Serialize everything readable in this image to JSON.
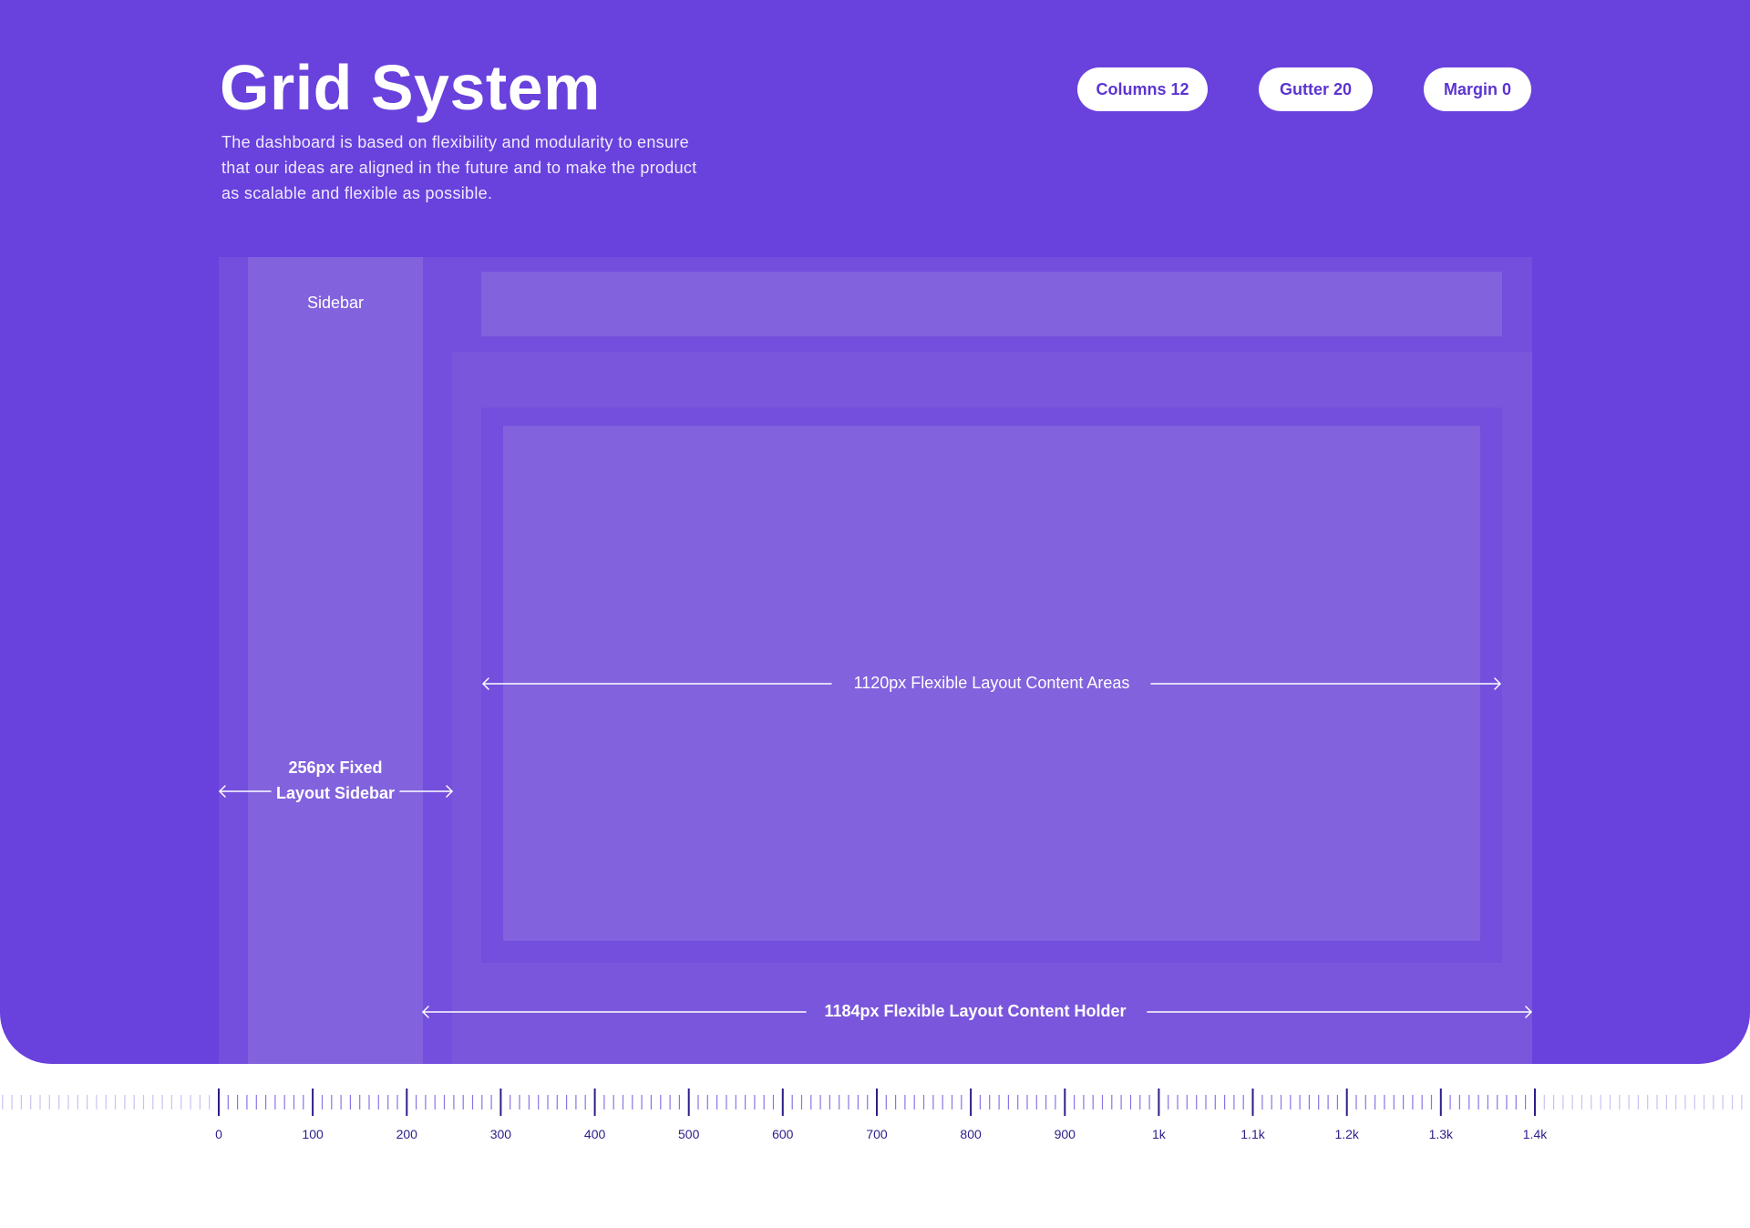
{
  "header": {
    "title": "Grid System",
    "description": "The dashboard is based on flexibility and modularity to ensure that our ideas are aligned in the future and to make the product as scalable and flexible as possible."
  },
  "specs": {
    "columns": "Columns 12",
    "gutter": "Gutter 20",
    "margin": "Margin 0"
  },
  "layout": {
    "sidebar_label": "Sidebar",
    "sidebar_dimension": "256px Fixed Layout Sidebar",
    "content_area_dimension": "1120px Flexible Layout Content Areas",
    "content_holder_dimension": "1184px Flexible Layout Content Holder"
  },
  "ruler": {
    "labels": [
      "0",
      "100",
      "200",
      "300",
      "400",
      "500",
      "600",
      "700",
      "800",
      "900",
      "1k",
      "1.1k",
      "1.2k",
      "1.3k",
      "1.4k"
    ]
  },
  "colors": {
    "background": "#6941dc",
    "panel": "#744edc",
    "column": "#8262dd",
    "ruler_major": "#2a1e88",
    "ruler_minor": "#8c73e6"
  }
}
